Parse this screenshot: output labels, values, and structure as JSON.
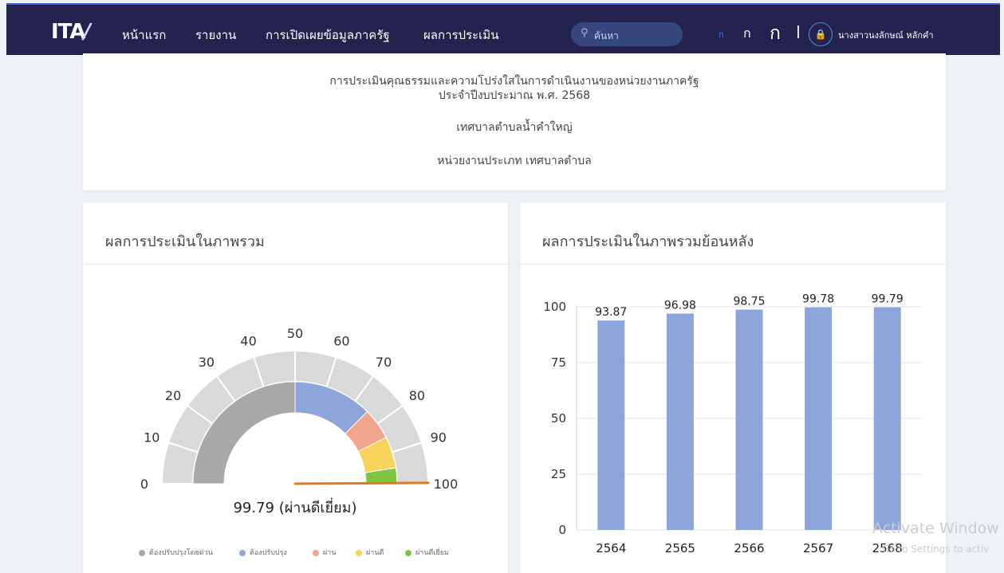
{
  "nav": {
    "logo": "ITA",
    "items": [
      "หน้าแรก",
      "รายงาน",
      "การเปิดเผยข้อมูลภาครัฐ",
      "ผลการประเมิน"
    ],
    "search_placeholder": "ค้นหา",
    "font_sizes": [
      "ก",
      "ก",
      "ก"
    ],
    "user_name": "นางสาวนงลักษณ์ หลักคำ"
  },
  "info": {
    "line1": "การประเมินคุณธรรมและความโปร่งใสในการดำเนินงานของหน่วยงานภาครัฐ",
    "line2": "ประจำปีงบประมาณ พ.ศ. 2568",
    "org": "เทศบาลตำบลน้ำคำใหญ่",
    "org_type": "หน่วยงานประเภท เทศบาลตำบล"
  },
  "gauge_card": {
    "title": "ผลการประเมินในภาพรวม"
  },
  "history_card": {
    "title": "ผลการประเมินในภาพรวมย้อนหลัง"
  },
  "chart_data": [
    {
      "type": "gauge",
      "min": 0,
      "max": 100,
      "ticks": [
        "0",
        "10",
        "20",
        "30",
        "40",
        "50",
        "60",
        "70",
        "80",
        "90",
        "100"
      ],
      "value": 99.79,
      "value_label": "99.79 (ผ่านดีเยี่ยม)",
      "bands": [
        {
          "name": "ต้องปรับปรุงโดยด่วน",
          "from": 0,
          "to": 50,
          "color": "#a9a7a8"
        },
        {
          "name": "ต้องปรับปรุง",
          "from": 50,
          "to": 75,
          "color": "#8ea5dc"
        },
        {
          "name": "ผ่าน",
          "from": 75,
          "to": 85,
          "color": "#f2a58c"
        },
        {
          "name": "ผ่านดี",
          "from": 85,
          "to": 95,
          "color": "#f7d35a"
        },
        {
          "name": "ผ่านดีเยี่ยม",
          "from": 95,
          "to": 100,
          "color": "#7dc642"
        }
      ],
      "legend": [
        {
          "label": "ต้องปรับปรุงโดยด่วน",
          "color": "#a9a7a8"
        },
        {
          "label": "ต้องปรับปรุง",
          "color": "#8ea5dc"
        },
        {
          "label": "ผ่าน",
          "color": "#f2a58c"
        },
        {
          "label": "ผ่านดี",
          "color": "#f7d35a"
        },
        {
          "label": "ผ่านดีเยี่ยม",
          "color": "#7dc642"
        }
      ],
      "needle_color": "#e07a1f"
    },
    {
      "type": "bar",
      "categories": [
        "2564",
        "2565",
        "2566",
        "2567",
        "2568"
      ],
      "values": [
        93.87,
        96.98,
        98.75,
        99.78,
        99.79
      ],
      "data_labels": [
        "93.87",
        "96.98",
        "98.75",
        "99.78",
        "99.79"
      ],
      "yticks": [
        "0",
        "25",
        "50",
        "75",
        "100"
      ],
      "ylim": [
        0,
        100
      ],
      "grid": true,
      "color": "#8ea5dc"
    }
  ],
  "watermark": {
    "line1": "Activate Window",
    "line2": "Go to Settings to activ"
  }
}
